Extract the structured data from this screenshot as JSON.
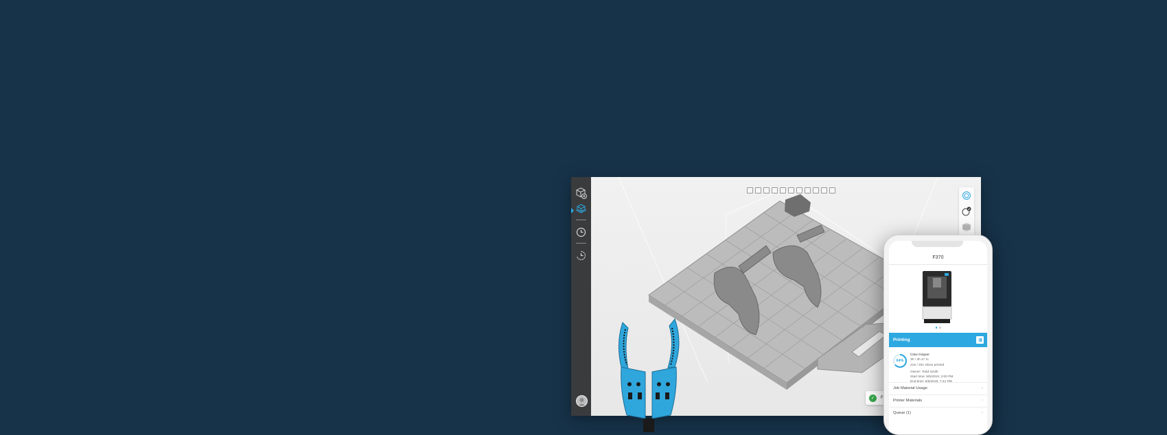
{
  "colors": {
    "background": "#17334a",
    "accent": "#2da8e0",
    "success": "#3aa94d",
    "sidebar": "#3a3b3d"
  },
  "sidebar": {
    "items": [
      {
        "icon": "add-part-icon",
        "active": false
      },
      {
        "icon": "build-plate-icon",
        "active": true
      },
      {
        "icon": "clock-icon",
        "active": false
      },
      {
        "icon": "history-icon",
        "active": false
      }
    ],
    "avatar_icon": "user-avatar-icon"
  },
  "viewport": {
    "toolbar_icons": [
      "view-front-icon",
      "view-back-icon",
      "view-left-icon",
      "view-right-icon",
      "view-top-icon",
      "view-bottom-icon",
      "view-iso-icon",
      "view-iso-alt-icon",
      "zoom-fit-icon",
      "zoom-select-icon",
      "zoom-all-icon"
    ],
    "right_tools": [
      "orient-icon",
      "check-orient-icon",
      "slice-layers-icon"
    ],
    "printer_pill": {
      "label": "F370",
      "status_icon": "check-icon"
    }
  },
  "phone": {
    "title": "F370",
    "carousel_count": 2,
    "carousel_active": 0,
    "status": {
      "label": "Printing",
      "action_icon": "pause-icon"
    },
    "job": {
      "progress_label": "64%",
      "progress": 0.64,
      "name": "Claw Gripper",
      "time_remaining": "3h / 3h 47 m",
      "slices": "215 / 331 slices printed",
      "owner": "Owner: Todd Smith",
      "start_time": "Start time: 5/5/2019, 3:00 PM",
      "end_time": "End time: 5/5/2019, 7:41 PM"
    },
    "menu": [
      {
        "label": "Job Material Usage"
      },
      {
        "label": "Printer Materials"
      },
      {
        "label": "Queue (1)"
      }
    ]
  }
}
